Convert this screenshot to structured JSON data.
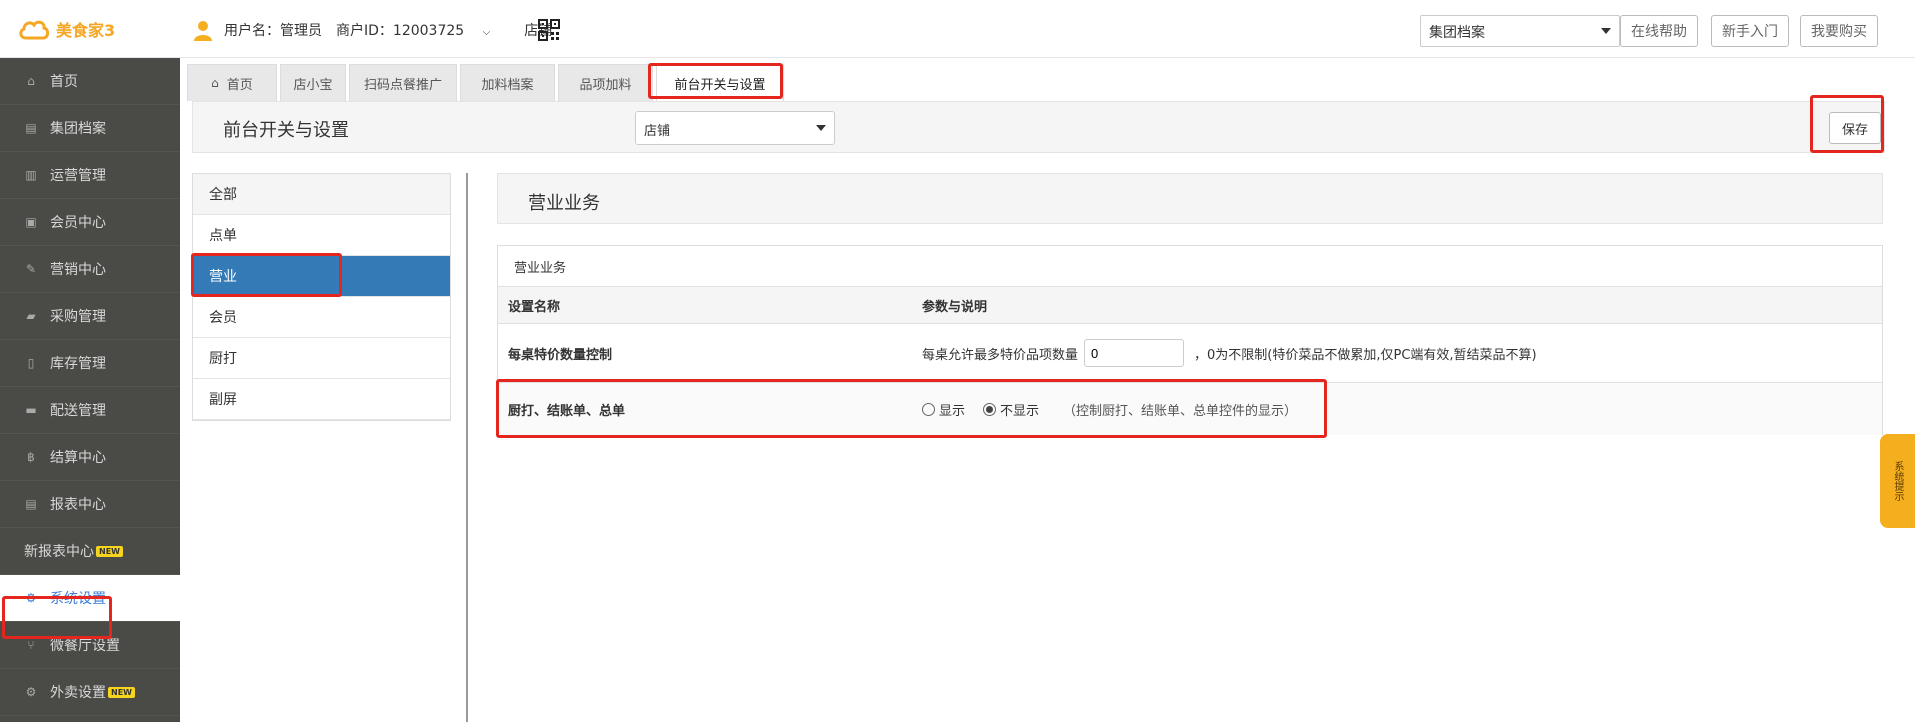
{
  "app": {
    "logo_text": "美食家3"
  },
  "user": {
    "username_label": "用户名：管理员",
    "merchant_label": "商户ID：12003725",
    "store_label": "店铺"
  },
  "header": {
    "group_select_value": "集团档案",
    "buttons": [
      "在线帮助",
      "新手入门",
      "我要购买"
    ]
  },
  "sidebar": {
    "items": [
      {
        "label": "首页",
        "icon": "home-icon",
        "glyph": "⌂"
      },
      {
        "label": "集团档案",
        "icon": "file-icon",
        "glyph": "▤"
      },
      {
        "label": "运营管理",
        "icon": "bar-chart-icon",
        "glyph": "▥"
      },
      {
        "label": "会员中心",
        "icon": "member-card-icon",
        "glyph": "▣"
      },
      {
        "label": "营销中心",
        "icon": "edit-icon",
        "glyph": "✎"
      },
      {
        "label": "采购管理",
        "icon": "book-icon",
        "glyph": "▰"
      },
      {
        "label": "库存管理",
        "icon": "inventory-icon",
        "glyph": "▯"
      },
      {
        "label": "配送管理",
        "icon": "truck-icon",
        "glyph": "▬"
      },
      {
        "label": "结算中心",
        "icon": "bitcoin-icon",
        "glyph": "฿"
      },
      {
        "label": "报表中心",
        "icon": "report-icon",
        "glyph": "▤"
      },
      {
        "label": "新报表中心",
        "icon": "",
        "glyph": "",
        "badge": "NEW"
      },
      {
        "label": "系统设置",
        "icon": "gears-icon",
        "glyph": "⚙"
      },
      {
        "label": "微餐厅设置",
        "icon": "cutlery-icon",
        "glyph": "⑂"
      },
      {
        "label": "外卖设置",
        "icon": "gear-icon",
        "glyph": "⚙",
        "badge": "NEW"
      }
    ]
  },
  "tabs": [
    {
      "label": "首页",
      "icon": "home-icon"
    },
    {
      "label": "店小宝"
    },
    {
      "label": "扫码点餐推广"
    },
    {
      "label": "加料档案"
    },
    {
      "label": "品项加料"
    },
    {
      "label": "前台开关与设置"
    }
  ],
  "page": {
    "title": "前台开关与设置",
    "store_select_value": "店铺",
    "save_label": "保存"
  },
  "categories": [
    "全部",
    "点单",
    "营业",
    "会员",
    "厨打",
    "副屏"
  ],
  "section": {
    "title": "营业业务",
    "panel_title": "营业业务",
    "col_name": "设置名称",
    "col_param": "参数与说明",
    "rows": [
      {
        "name": "每桌特价数量控制",
        "prefix": "每桌允许最多特价品项数量",
        "input_value": "0",
        "suffix": "，0为不限制(特价菜品不做累加,仅PC端有效,暂结菜品不算)"
      },
      {
        "name": "厨打、结账单、总单",
        "option_show": "显示",
        "option_hide": "不显示",
        "note": "（控制厨打、结账单、总单控件的显示）"
      }
    ]
  },
  "system_tip": "系统提示"
}
